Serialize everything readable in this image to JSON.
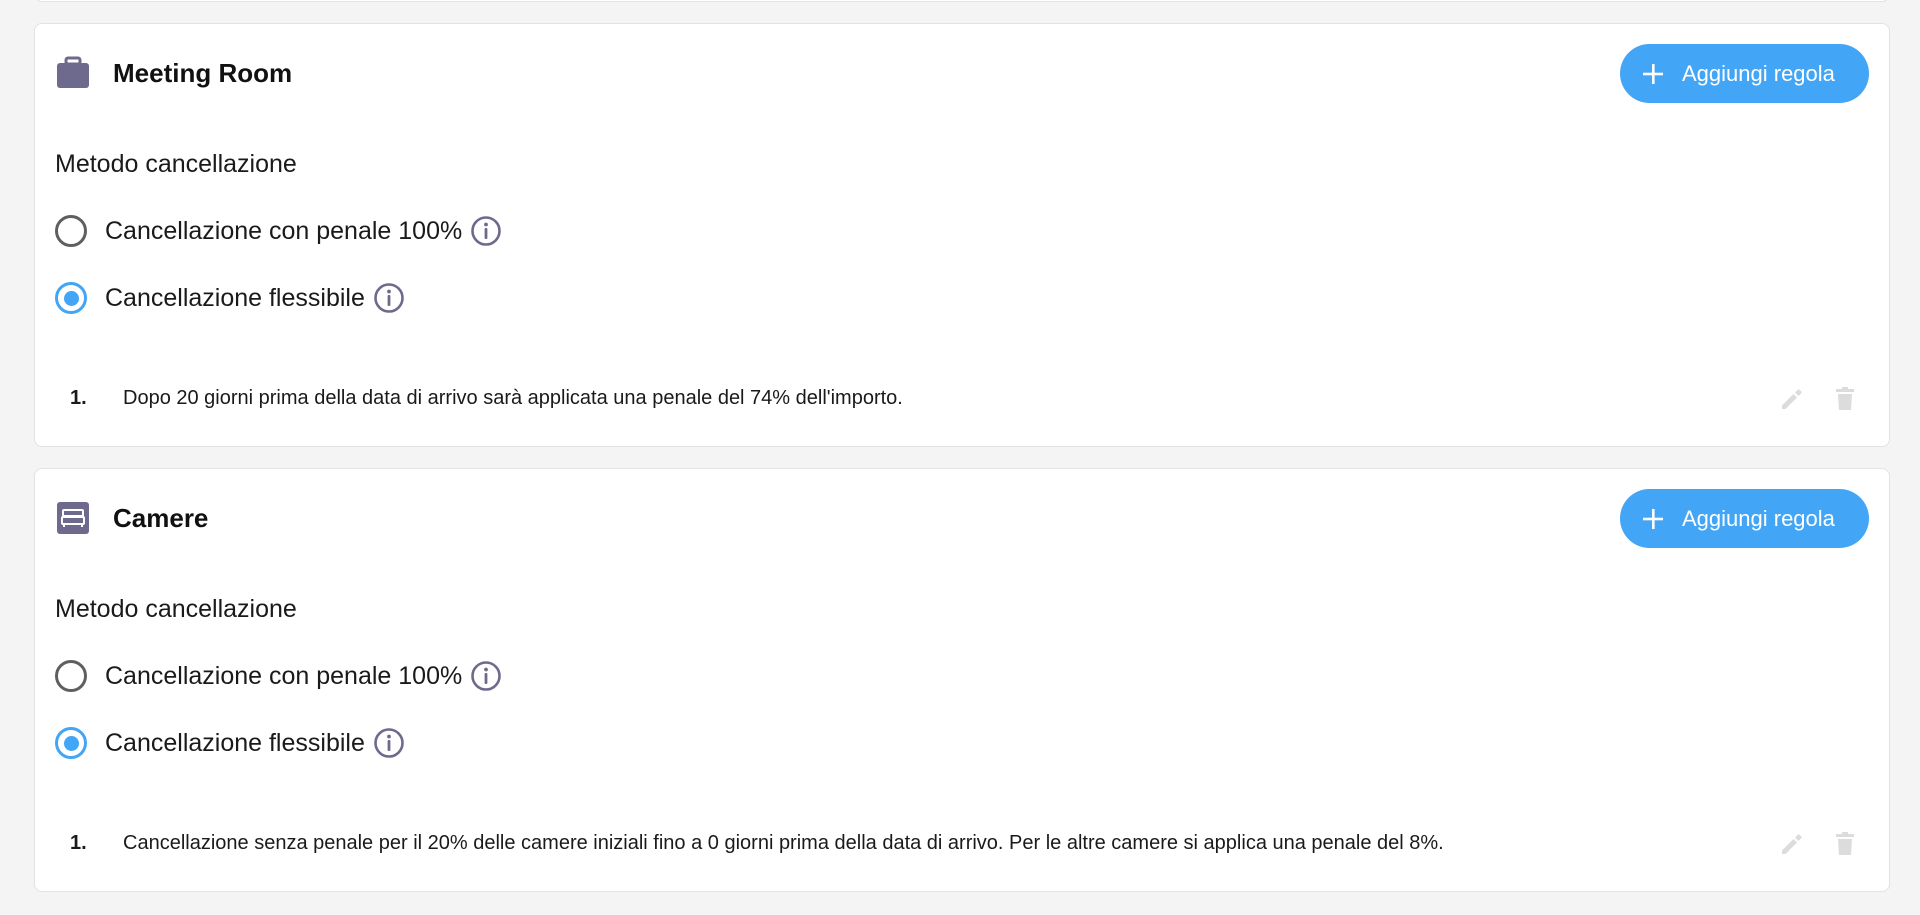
{
  "sections": [
    {
      "title": "Meeting Room",
      "icon": "briefcase-icon",
      "add_button_label": "Aggiungi regola",
      "method_label": "Metodo cancellazione",
      "options": [
        {
          "label": "Cancellazione con penale 100%",
          "checked": false
        },
        {
          "label": "Cancellazione flessibile",
          "checked": true
        }
      ],
      "rules": [
        {
          "number": "1.",
          "text": "Dopo 20 giorni prima della data di arrivo sarà applicata una penale del 74% dell'importo."
        }
      ]
    },
    {
      "title": "Camere",
      "icon": "bed-icon",
      "add_button_label": "Aggiungi regola",
      "method_label": "Metodo cancellazione",
      "options": [
        {
          "label": "Cancellazione con penale 100%",
          "checked": false
        },
        {
          "label": "Cancellazione flessibile",
          "checked": true
        }
      ],
      "rules": [
        {
          "number": "1.",
          "text": "Cancellazione senza penale per il 20% delle camere iniziali fino a 0 giorni prima della data di arrivo. Per le altre camere si applica una penale del 8%."
        }
      ]
    }
  ],
  "colors": {
    "accent": "#42a5f5",
    "icon_purple": "#6e6a8e",
    "info_icon": "#6e6a8e",
    "disabled_action": "#dcdcdc",
    "background": "#f4f4f4",
    "card": "#ffffff"
  }
}
